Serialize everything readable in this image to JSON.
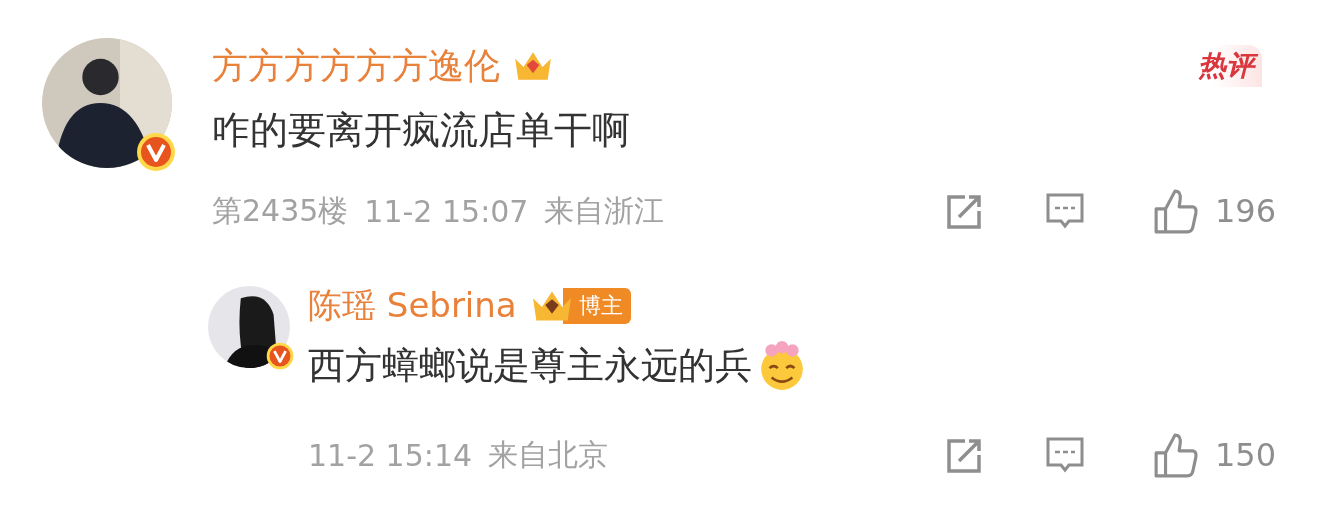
{
  "comment": {
    "author": "方方方方方方逸伦",
    "verified": true,
    "hot_label": "热评",
    "text": "咋的要离开疯流店单干啊",
    "floor": "第2435楼",
    "time": "11-2 15:07",
    "location": "来自浙江",
    "likes": "196"
  },
  "reply": {
    "author": "陈瑶 Sebrina",
    "verified": true,
    "badge": "博主",
    "text": "西方蟑螂说是尊主永远的兵",
    "time": "11-2 15:14",
    "location": "来自北京",
    "likes": "150"
  }
}
